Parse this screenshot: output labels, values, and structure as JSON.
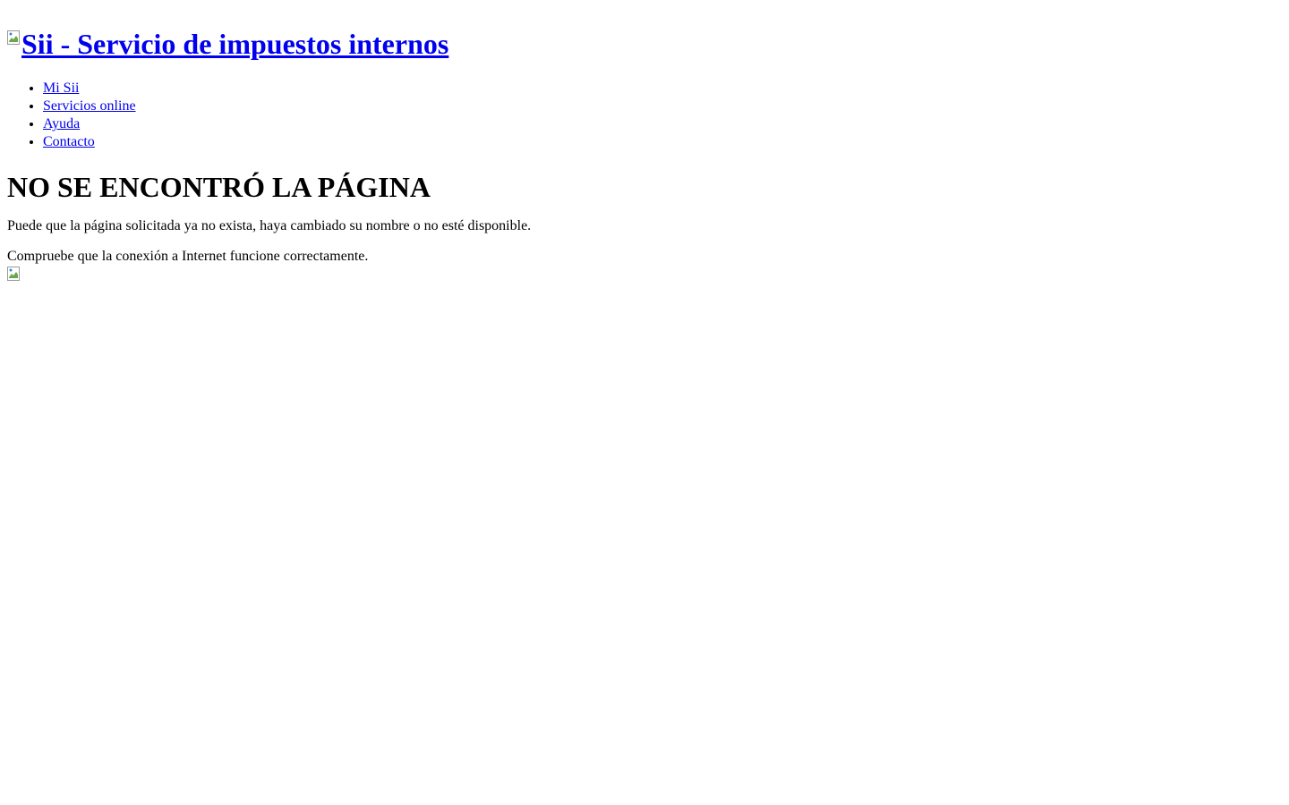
{
  "header": {
    "logo_alt": "Sii - Servicio de impuestos internos",
    "logo_icon": "broken-image-icon"
  },
  "nav": {
    "items": [
      {
        "label": "Mi Sii"
      },
      {
        "label": "Servicios online"
      },
      {
        "label": "Ayuda"
      },
      {
        "label": "Contacto"
      }
    ]
  },
  "main": {
    "title": "NO SE ENCONTRÓ LA PÁGINA",
    "message_1": "Puede que la página solicitada ya no exista, haya cambiado su nombre o no esté disponible.",
    "message_2": "Compruebe que la conexión a Internet funcione correctamente.",
    "bottom_image_icon": "broken-image-icon"
  },
  "colors": {
    "link": "#0000ee",
    "text": "#000000",
    "background": "#ffffff"
  }
}
